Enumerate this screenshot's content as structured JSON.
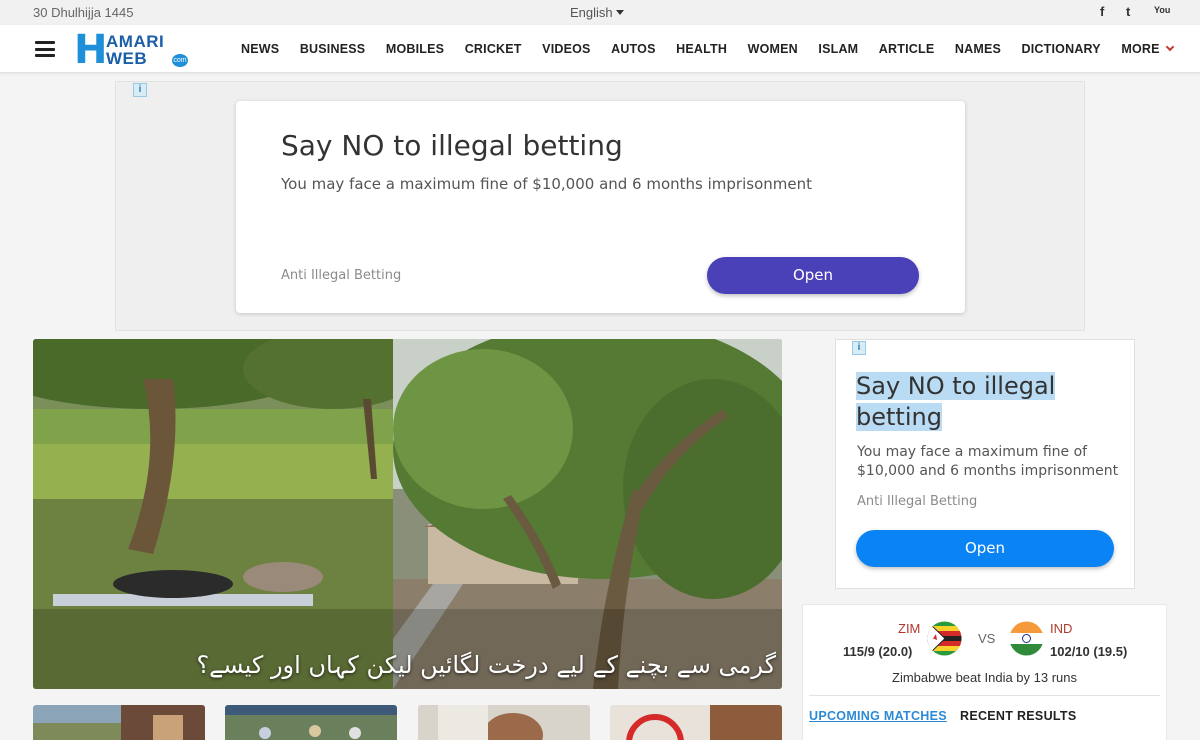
{
  "topbar": {
    "date": "30 Dhulhijja 1445",
    "language": "English"
  },
  "social": {
    "facebook": "f",
    "twitter": "t",
    "youtube": "You"
  },
  "logo": {
    "h": "H",
    "amari": "AMARI",
    "web": "WEB",
    "com": "com"
  },
  "nav": {
    "items": [
      "NEWS",
      "BUSINESS",
      "MOBILES",
      "CRICKET",
      "VIDEOS",
      "AUTOS",
      "HEALTH",
      "WOMEN",
      "ISLAM",
      "ARTICLE",
      "NAMES",
      "DICTIONARY"
    ],
    "more": "MORE"
  },
  "ad_top": {
    "badge": "i",
    "title": "Say NO to illegal betting",
    "subtitle": "You may face a maximum fine of $10,000 and 6 months imprisonment",
    "brand": "Anti Illegal Betting",
    "cta": "Open"
  },
  "hero": {
    "caption": "گرمی سے بچنے کے لیے درخت لگائیں لیکن کہاں اور کیسے؟"
  },
  "ad_side": {
    "badge": "i",
    "title": "Say NO to illegal betting",
    "subtitle": "You may face a maximum fine of $10,000 and 6 months imprisonment",
    "brand": "Anti Illegal Betting",
    "cta": "Open"
  },
  "cricket": {
    "team1": {
      "name": "ZIM",
      "score": "115/9 (20.0)"
    },
    "vs": "VS",
    "team2": {
      "name": "IND",
      "score": "102/10 (19.5)"
    },
    "result": "Zimbabwe beat India by 13 runs",
    "tabs": {
      "upcoming": "UPCOMING MATCHES",
      "recent": "RECENT RESULTS"
    }
  },
  "colors": {
    "brand_blue": "#1b5ea8",
    "ad_button_top": "#4a40b8",
    "ad_button_side": "#0a84f5",
    "team_red": "#b03a2e",
    "tab_blue": "#2b8ad6"
  }
}
